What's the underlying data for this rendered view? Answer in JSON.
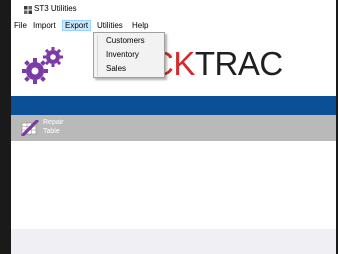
{
  "window": {
    "title": "ST3 Utilities"
  },
  "menubar": {
    "items": [
      {
        "label": "File"
      },
      {
        "label": "Import"
      },
      {
        "label": "Export"
      },
      {
        "label": "Utilities"
      },
      {
        "label": "Help"
      }
    ]
  },
  "export_menu": {
    "items": [
      {
        "label": "Customers"
      },
      {
        "label": "Inventory"
      },
      {
        "label": "Sales"
      }
    ]
  },
  "logo": {
    "text_visible_red": "CK",
    "text_visible_dark": "TRAC"
  },
  "toolbar": {
    "repair_label_line1": "Repair",
    "repair_label_line2": "Table"
  },
  "colors": {
    "accent_blue": "#0b4f96",
    "toolbar_grey": "#b9b9b9",
    "gear_purple": "#7b3aa6",
    "logo_red": "#d42a2a",
    "menu_highlight": "#cce8ff"
  }
}
